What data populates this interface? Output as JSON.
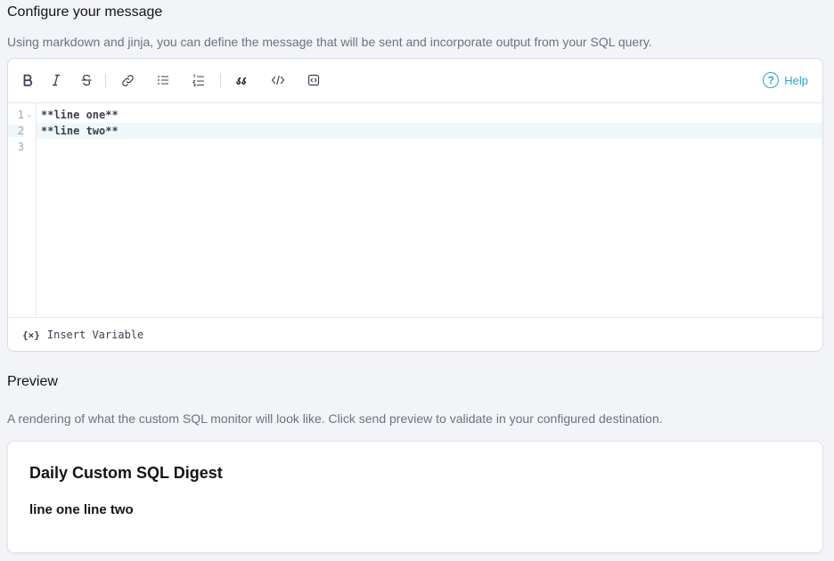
{
  "message_section": {
    "title": "Configure your message",
    "description": "Using markdown and jinja, you can define the message that will be sent and incorporate output from your SQL query."
  },
  "toolbar": {
    "help_label": "Help",
    "help_glyph": "?",
    "buttons": [
      "bold-icon",
      "italic-icon",
      "strikethrough-icon",
      "link-icon",
      "bullet-list-icon",
      "numbered-list-icon",
      "quote-icon",
      "code-icon",
      "code-block-icon"
    ]
  },
  "editor": {
    "line_numbers": [
      "1",
      "2",
      "3"
    ],
    "lines": [
      "**line one**",
      "**line two**",
      ""
    ],
    "active_line": 2
  },
  "footer": {
    "insert_variable_icon": "{×}",
    "insert_variable_label": "Insert Variable"
  },
  "preview_section": {
    "title": "Preview",
    "description": "A rendering of what the custom SQL monitor will look like. Click send preview to validate in your configured destination.",
    "card_title": "Daily Custom SQL Digest",
    "card_body": "line one line two"
  },
  "colors": {
    "accent": "#2fa3c9",
    "background": "#f3f4f7",
    "active_line": "#eef8fb"
  }
}
